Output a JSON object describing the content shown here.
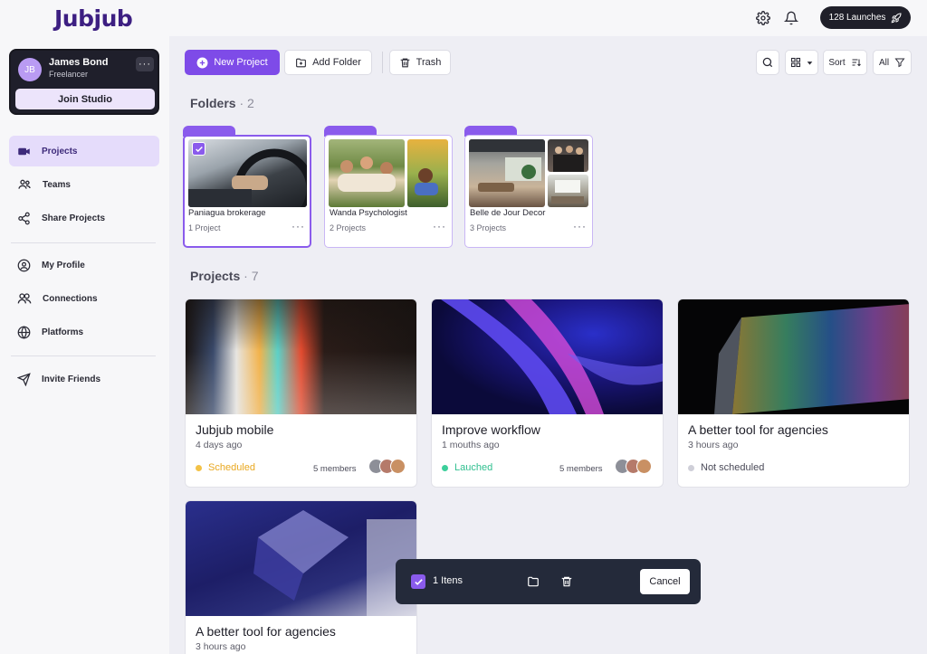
{
  "app": {
    "logo": "Jubjub",
    "launch_label": "128 Launches"
  },
  "user": {
    "initials": "JB",
    "name": "James Bond",
    "role": "Freelancer",
    "more": "···",
    "join_label": "Join Studio"
  },
  "sidebar": {
    "items": [
      {
        "label": "Projects"
      },
      {
        "label": "Teams"
      },
      {
        "label": "Share Projects"
      },
      {
        "label": "My Profile"
      },
      {
        "label": "Connections"
      },
      {
        "label": "Platforms"
      },
      {
        "label": "Invite Friends"
      }
    ]
  },
  "toolbar": {
    "new_project": "New Project",
    "add_folder": "Add Folder",
    "trash": "Trash",
    "sort": "Sort",
    "all": "All"
  },
  "folders": {
    "title": "Folders",
    "count": "· 2",
    "items": [
      {
        "name": "Paniagua brokerage",
        "count": "1 Project"
      },
      {
        "name": "Wanda Psychologist",
        "count": "2 Projects"
      },
      {
        "name": "Belle de Jour Decor",
        "count": "3 Projects"
      }
    ],
    "more": "···"
  },
  "projects": {
    "title": "Projects",
    "count": "· 7",
    "items": [
      {
        "title": "Jubjub mobile",
        "time": "4 days ago",
        "status": "Scheduled",
        "status_color": "#e9a820",
        "members": "5 members"
      },
      {
        "title": "Improve workflow",
        "time": "1 mouths ago",
        "status": "Lauched",
        "status_color": "#2fbf8f",
        "members": "5 members"
      },
      {
        "title": "A better tool for agencies",
        "time": "3 hours ago",
        "status": "Not scheduled",
        "status_color": "#c5c5cf",
        "members": ""
      },
      {
        "title": "A better tool for agencies",
        "time": "3 hours ago",
        "status": "",
        "status_color": "",
        "members": ""
      }
    ]
  },
  "selection": {
    "count_label": "1 Itens",
    "cancel": "Cancel"
  },
  "colors": {
    "accent": "#7e4be8",
    "dark": "#1f1f29"
  }
}
